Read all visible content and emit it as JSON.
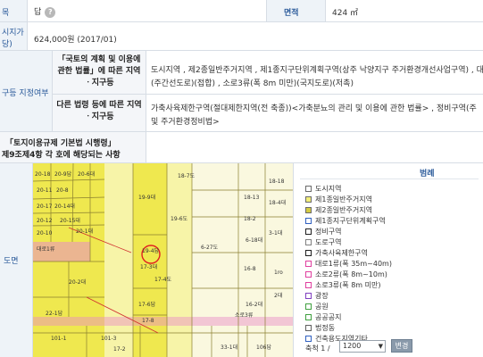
{
  "row_jimok": {
    "label": "목",
    "value": "답"
  },
  "row_area": {
    "label": "면적",
    "value": "424 ㎡"
  },
  "row_price": {
    "label_line1": "시지가",
    "label_line2": "당)",
    "value": "624,000원 (2017/01)"
  },
  "zone_section": {
    "label": "구등 지정여부",
    "sub1_label": "「국토의 계획 및 이용에 관한 법률」에 따른 지역ㆍ지구등",
    "sub1_value_line1": "도시지역 , 제2종일반주거지역 , 제1종지구단위계획구역(상주 낙양지구 주거환경개선사업구역) , 대",
    "sub1_value_line2": "(주간선도로)(접합) , 소로3류(폭 8m 미만)(국지도로)(저촉)",
    "sub2_label": "다른 법령 등에 따른 지역ㆍ지구등",
    "sub2_value_line1": "가축사육제한구역(절대제한지역(전 축종))<가축분뇨의 관리 및 이용에 관한 법률> , 정비구역(주",
    "sub2_value_line2": "및 주거환경정비법>"
  },
  "regulation": {
    "label_line1": "「토지이용규제 기본법 시행령」",
    "label_line2": "제9조제4항 각 호에 해당되는 사항",
    "value": ""
  },
  "map_section": {
    "label": "도면"
  },
  "map": {
    "labels": [
      "20-18",
      "20-9답",
      "20-6대",
      "20-11",
      "20-8",
      "20-17",
      "20-14대",
      "20-15대",
      "20-1대",
      "20-12",
      "20-10",
      "20-2대",
      "19-9대",
      "19-6도",
      "18-7도",
      "6-27도",
      "6-18대",
      "16-8",
      "16-2대",
      "17-4도",
      "17-3대",
      "17-6답",
      "17-8",
      "17-2",
      "101-3",
      "101-1",
      "소로3류",
      "대로1류",
      "3-1대",
      "18-4대",
      "18-18",
      "18-13",
      "18-2",
      "106답",
      "1ro",
      "2대",
      "33-1대",
      "22-1답",
      "19-4답"
    ],
    "subject_label": "19-4답"
  },
  "legend": {
    "title": "범례",
    "items": [
      {
        "label": "도시지역",
        "color": "#ffffff"
      },
      {
        "label": "제1종일반주거지역",
        "color": "#f2ee7a"
      },
      {
        "label": "제2종일반주거지역",
        "color": "#d4cc44"
      },
      {
        "label": "제1종지구단위계획구역",
        "color": "#ffffff"
      },
      {
        "label": "정비구역",
        "color": "#ffffff"
      },
      {
        "label": "도로구역",
        "color": "#ffffff"
      },
      {
        "label": "가축사육제한구역",
        "color": "#ffffff"
      },
      {
        "label": "대로1류(폭 35m~40m)",
        "color": "#ffffff"
      },
      {
        "label": "소로2류(폭 8m~10m)",
        "color": "#ffffff"
      },
      {
        "label": "소로3류(폭 8m 미만)",
        "color": "#ffffff"
      },
      {
        "label": "광장",
        "color": "#ffffff"
      },
      {
        "label": "공원",
        "color": "#ffffff"
      },
      {
        "label": "공공공지",
        "color": "#ffffff"
      },
      {
        "label": "법정동",
        "color": "#ffffff"
      },
      {
        "label": "건축용도지역기타",
        "color": "#ffffff"
      }
    ]
  },
  "scale": {
    "label": "축척 1 /",
    "value": "1200",
    "button": "변경"
  }
}
